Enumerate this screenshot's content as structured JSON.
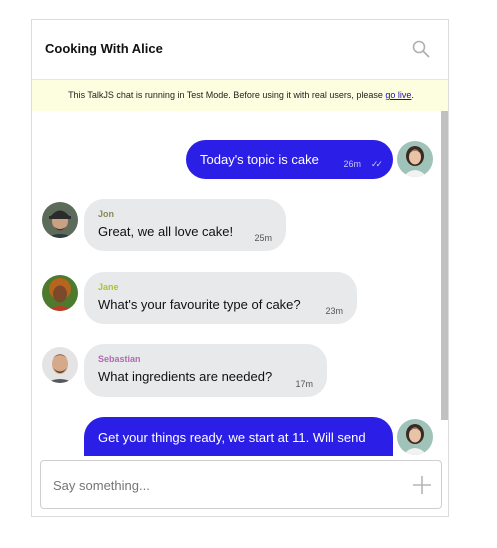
{
  "header": {
    "title": "Cooking With Alice"
  },
  "banner": {
    "text": "This TalkJS chat is running in Test Mode. Before using it with real users, please ",
    "link": "go live",
    "suffix": "."
  },
  "messages": [
    {
      "text": "Today's topic is cake",
      "time": "26m",
      "status": "✓✓"
    },
    {
      "sender": "Jon",
      "text": "Great, we all love cake!",
      "time": "25m"
    },
    {
      "sender": "Jane",
      "text": "What's your favourite type of cake?",
      "time": "23m"
    },
    {
      "sender": "Sebastian",
      "text": "What ingredients are needed?",
      "time": "17m"
    },
    {
      "text": "Get your things ready, we start at 11. Will send"
    }
  ],
  "composer": {
    "placeholder": "Say something..."
  },
  "colors": {
    "outgoing": "#2b1ee6",
    "incoming": "#e7e9eb",
    "jon": "#8a8a5a",
    "jane": "#a4c639",
    "sebastian": "#b06ab3"
  }
}
